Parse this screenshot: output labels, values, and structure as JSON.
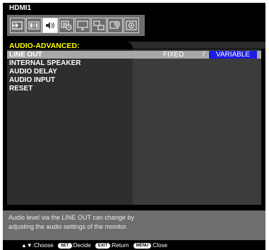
{
  "header": {
    "source": "HDMI1"
  },
  "icon_bar": {
    "icons": [
      "input-icon",
      "picture-icon",
      "audio-icon",
      "schedule-icon",
      "display-icon",
      "multi-input-icon",
      "protect-icon",
      "system-icon"
    ],
    "selected_index": 2
  },
  "section": {
    "title": "AUDIO-ADVANCED:"
  },
  "menu": {
    "items": [
      {
        "label": "LINE OUT"
      },
      {
        "label": "INTERNAL SPEAKER"
      },
      {
        "label": "AUDIO DELAY"
      },
      {
        "label": "AUDIO INPUT"
      },
      {
        "label": "RESET"
      }
    ],
    "selected_index": 0
  },
  "options": {
    "fixed": "FIXED",
    "separator": "/",
    "variable": "VARIABLE",
    "selected": "VARIABLE"
  },
  "help": {
    "line1": "Audio level via the LINE OUT can change by",
    "line2": "adjusting the audio settings of the monitor."
  },
  "footer": {
    "arrows": "▲▼",
    "choose": ":Choose",
    "set_key": "SET",
    "decide": ":Decide",
    "exit_key": "EXIT",
    "return": ":Return",
    "menu_key": "MENU",
    "close": ":Close"
  },
  "colors": {
    "title_yellow": "#ffff00",
    "selection_blue": "#1c1ce6",
    "highlight_gray": "#a8a8a8"
  }
}
